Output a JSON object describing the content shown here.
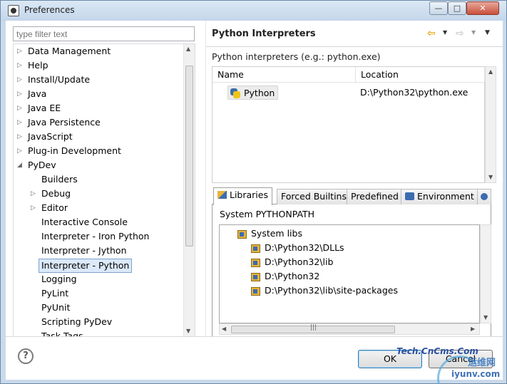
{
  "window": {
    "title": "Preferences",
    "controls": {
      "minimize": "—",
      "maximize": "□",
      "close": "✕"
    }
  },
  "left": {
    "filter_placeholder": "type filter text",
    "tree": [
      {
        "label": "Data Management",
        "level": 0,
        "expander": "collapsed"
      },
      {
        "label": "Help",
        "level": 0,
        "expander": "collapsed"
      },
      {
        "label": "Install/Update",
        "level": 0,
        "expander": "collapsed"
      },
      {
        "label": "Java",
        "level": 0,
        "expander": "collapsed"
      },
      {
        "label": "Java EE",
        "level": 0,
        "expander": "collapsed"
      },
      {
        "label": "Java Persistence",
        "level": 0,
        "expander": "collapsed"
      },
      {
        "label": "JavaScript",
        "level": 0,
        "expander": "collapsed"
      },
      {
        "label": "Plug-in Development",
        "level": 0,
        "expander": "collapsed"
      },
      {
        "label": "PyDev",
        "level": 0,
        "expander": "expanded"
      },
      {
        "label": "Builders",
        "level": 1,
        "expander": "none"
      },
      {
        "label": "Debug",
        "level": 1,
        "expander": "collapsed"
      },
      {
        "label": "Editor",
        "level": 1,
        "expander": "collapsed"
      },
      {
        "label": "Interactive Console",
        "level": 1,
        "expander": "none"
      },
      {
        "label": "Interpreter - Iron Python",
        "level": 1,
        "expander": "none"
      },
      {
        "label": "Interpreter - Jython",
        "level": 1,
        "expander": "none"
      },
      {
        "label": "Interpreter - Python",
        "level": 1,
        "expander": "none",
        "selected": true
      },
      {
        "label": "Logging",
        "level": 1,
        "expander": "none"
      },
      {
        "label": "PyLint",
        "level": 1,
        "expander": "none"
      },
      {
        "label": "PyUnit",
        "level": 1,
        "expander": "none"
      },
      {
        "label": "Scripting PyDev",
        "level": 1,
        "expander": "none"
      },
      {
        "label": "Task Tags",
        "level": 1,
        "expander": "none"
      }
    ]
  },
  "right": {
    "title": "Python Interpreters",
    "description": "Python interpreters (e.g.: python.exe)",
    "table": {
      "headers": {
        "name": "Name",
        "location": "Location"
      },
      "rows": [
        {
          "name": "Python",
          "location": "D:\\Python32\\python.exe"
        }
      ]
    },
    "tabs": [
      {
        "label": "Libraries",
        "active": true
      },
      {
        "label": "Forced Builtins"
      },
      {
        "label": "Predefined"
      },
      {
        "label": "Environment"
      }
    ],
    "section_label": "System PYTHONPATH",
    "libraries": {
      "root": "System libs",
      "items": [
        "D:\\Python32\\DLLs",
        "D:\\Python32\\lib",
        "D:\\Python32",
        "D:\\Python32\\lib\\site-packages"
      ]
    }
  },
  "buttons": {
    "help": "?",
    "ok": "OK",
    "cancel": "Cancel"
  },
  "watermark": {
    "line1": "Tech.CnCms.Com",
    "line2": "运维网",
    "line3": "iyunv.com"
  },
  "colors": {
    "selection_bg": "#dbe9fa",
    "selection_border": "#7da2ce",
    "nav_back": "#e8a313"
  }
}
